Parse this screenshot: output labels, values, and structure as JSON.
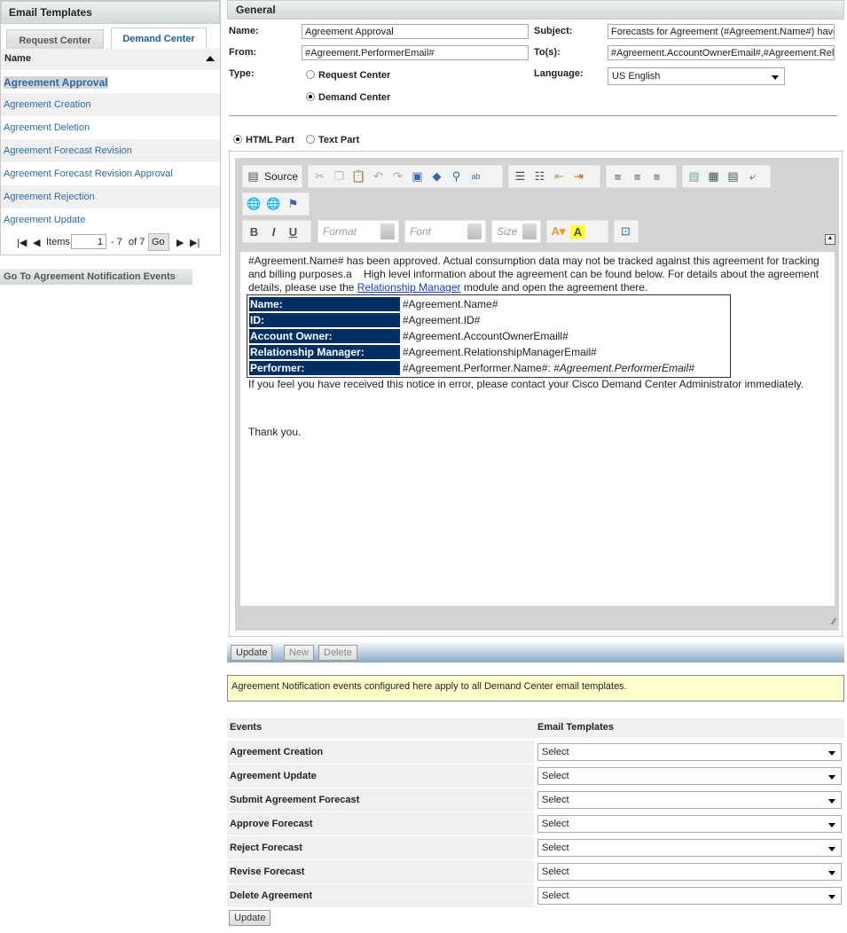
{
  "left": {
    "title": "Email Templates",
    "tabs": [
      "Request Center",
      "Demand Center"
    ],
    "column": "Name",
    "items": [
      "Agreement Approval",
      "Agreement Creation",
      "Agreement Deletion",
      "Agreement Forecast Revision",
      "Agreement Forecast Revision Approval",
      "Agreement Rejection",
      "Agreement Update"
    ],
    "pager": {
      "items_label": "Items",
      "page_value": "1",
      "range": "- 7",
      "of": "of 7",
      "go": "Go"
    },
    "goto_events": "Go To Agreement Notification Events"
  },
  "general": {
    "title": "General",
    "name_label": "Name:",
    "name_value": "Agreement Approval",
    "from_label": "From:",
    "from_value": "#Agreement.PerformerEmail#",
    "type_label": "Type:",
    "type_options": [
      "Request Center",
      "Demand Center"
    ],
    "type_selected": "Demand Center",
    "subject_label": "Subject:",
    "subject_value": "Forecasts for Agreement (#Agreement.Name#) have",
    "to_label": "To(s):",
    "to_value": "#Agreement.AccountOwnerEmail#,#Agreement.Rela",
    "language_label": "Language:",
    "language_value": "US English"
  },
  "part": {
    "options": [
      "HTML Part",
      "Text Part"
    ],
    "selected": "HTML Part"
  },
  "toolbar": {
    "source": "Source",
    "format": "Format",
    "font": "Font",
    "size": "Size",
    "bold": "B",
    "italic": "I",
    "underline": "U"
  },
  "content": {
    "p1": "#Agreement.Name# has been approved. Actual consumption data may not be tracked against this agreement for tracking and billing purposes.a    High level information about the agreement can be found below. For details about the agreement details, please use the ",
    "link": "Relationship Manager",
    "p1b": " module and open the agreement there.",
    "table": [
      {
        "k": "Name:",
        "v": "#Agreement.Name#"
      },
      {
        "k": "ID:",
        "v": "#Agreement.ID#"
      },
      {
        "k": "Account Owner:",
        "v": "#Agreement.AccountOwnerEmaill#"
      },
      {
        "k": "Relationship Manager:",
        "v": "#Agreement.RelationshipManagerEmail#"
      },
      {
        "k": "Performer:",
        "v": "#Agreement.Performer.Name#: ",
        "v_italic": "#Agreement.PerformerEmail#"
      }
    ],
    "p2": "If you feel you have received this notice in error, please contact your Cisco Demand Center Administrator immediately.",
    "p3": "Thank you."
  },
  "actions": {
    "update": "Update",
    "new": "New",
    "delete": "Delete"
  },
  "note": "Agreement Notification events configured here apply to all Demand Center email templates.",
  "events": {
    "col1": "Events",
    "col2": "Email Templates",
    "rows": [
      {
        "event": "Agreement Creation",
        "template": "Select"
      },
      {
        "event": "Agreement Update",
        "template": "Select"
      },
      {
        "event": "Submit Agreement Forecast",
        "template": "Select"
      },
      {
        "event": "Approve Forecast",
        "template": "Select"
      },
      {
        "event": "Reject Forecast",
        "template": "Select"
      },
      {
        "event": "Revise Forecast",
        "template": "Select"
      },
      {
        "event": "Delete Agreement",
        "template": "Select"
      }
    ],
    "update": "Update"
  }
}
